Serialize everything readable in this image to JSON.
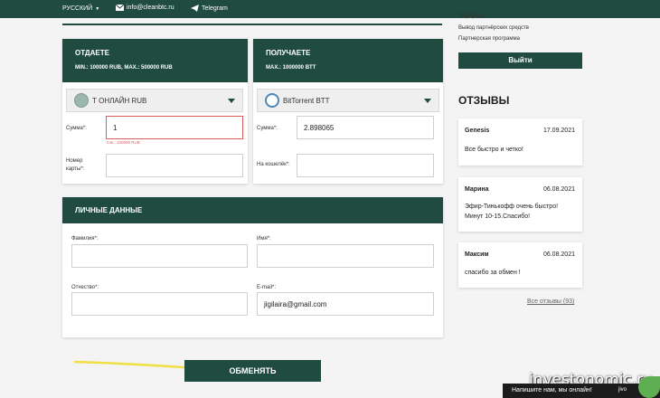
{
  "topbar": {
    "language": "РУССКИЙ",
    "email": "info@cleanbtc.ru",
    "telegram": "Telegram"
  },
  "give": {
    "title": "ОТДАЕТЕ",
    "limits": "MIN.: 100000 RUB, MAX.: 500000 RUB",
    "currency": "Т ОНЛАЙН RUB",
    "amount_label": "Сумма*:",
    "amount_value": "1",
    "amount_error": "min.: 100000 RUB",
    "card_label": "Номер карты*:",
    "card_value": ""
  },
  "get": {
    "title": "ПОЛУЧАЕТЕ",
    "limits": "MAX.: 1000000 BTT",
    "currency": "BitTorrent BTT",
    "amount_label": "Сумма*:",
    "amount_value": "2.898065",
    "wallet_label": "На кошелёк*:",
    "wallet_value": ""
  },
  "personal": {
    "title": "ЛИЧНЫЕ ДАННЫЕ",
    "surname_label": "Фамилия*:",
    "surname_value": "",
    "name_label": "Имя*:",
    "name_value": "",
    "patronymic_label": "Отчество*:",
    "patronymic_value": "",
    "email_label": "E-mail*:",
    "email_value": "jigilaira@gmail.com"
  },
  "exchange_button": "ОБМЕНЯТЬ",
  "sidebar": {
    "links": [
      "Рефералы",
      "Вывод партнёрских средств",
      "Партнерская программа"
    ],
    "logout": "Выйти",
    "reviews_title": "ОТЗЫВЫ",
    "reviews": [
      {
        "name": "Genesis",
        "date": "17.09.2021",
        "text": "Все быстро и четко!"
      },
      {
        "name": "Марина",
        "date": "06.08.2021",
        "text": "Эфир-Тинькофф очень быстро! Минут 10-15.Спасибо!"
      },
      {
        "name": "Максим",
        "date": "06.08.2021",
        "text": "спасибо за обмен !"
      }
    ],
    "all_reviews": "Все отзывы (93)"
  },
  "watermark": "investonomic.ru",
  "chat": {
    "text": "Напишите нам, мы онлайн!",
    "logo": "jivo"
  },
  "colors": {
    "brand": "#1f4b40",
    "error": "#d95b5b",
    "arrow": "#f2df43"
  }
}
